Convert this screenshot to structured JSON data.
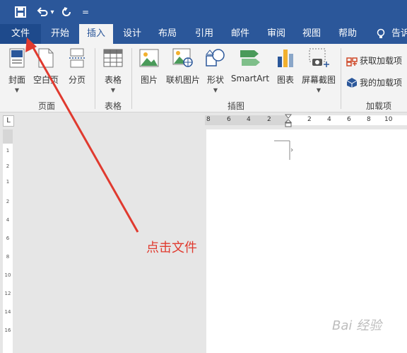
{
  "quick_access": {
    "save_icon": "save-icon",
    "undo_icon": "undo-icon",
    "undo_dropdown": "▾",
    "redo_icon": "redo-icon",
    "customize": "="
  },
  "tabs": [
    {
      "label": "文件",
      "state": "file"
    },
    {
      "label": "开始"
    },
    {
      "label": "插入",
      "state": "active"
    },
    {
      "label": "设计"
    },
    {
      "label": "布局"
    },
    {
      "label": "引用"
    },
    {
      "label": "邮件"
    },
    {
      "label": "审阅"
    },
    {
      "label": "视图"
    },
    {
      "label": "帮助"
    }
  ],
  "tell_me": {
    "icon": "lightbulb-icon",
    "label": "告诉"
  },
  "ribbon": {
    "pages_group": {
      "label": "页面",
      "cover": "封面",
      "blank": "空白页",
      "page_break": "分页"
    },
    "tables_group": {
      "label": "表格",
      "table": "表格"
    },
    "illustrations_group": {
      "label": "插图",
      "picture": "图片",
      "online_picture": "联机图片",
      "shapes": "形状",
      "smartart": "SmartArt",
      "chart": "图表",
      "screenshot": "屏幕截图"
    },
    "addins_group": {
      "label": "加载项",
      "get_addins": "获取加载项",
      "my_addins": "我的加载项"
    }
  },
  "ruler": {
    "corner": "L",
    "h_numbers": [
      "8",
      "6",
      "4",
      "2",
      "2",
      "4",
      "6",
      "8",
      "10"
    ],
    "v_numbers": [
      "1",
      "2",
      "1",
      "2",
      "4",
      "6",
      "8",
      "10",
      "12",
      "14",
      "16"
    ]
  },
  "annotation": {
    "text": "点击文件",
    "color": "#e03a2f"
  },
  "watermark": "Bai 经验",
  "colors": {
    "accent": "#2b579a",
    "ribbon": "#f3f3f3",
    "annotation": "#e03a2f"
  }
}
